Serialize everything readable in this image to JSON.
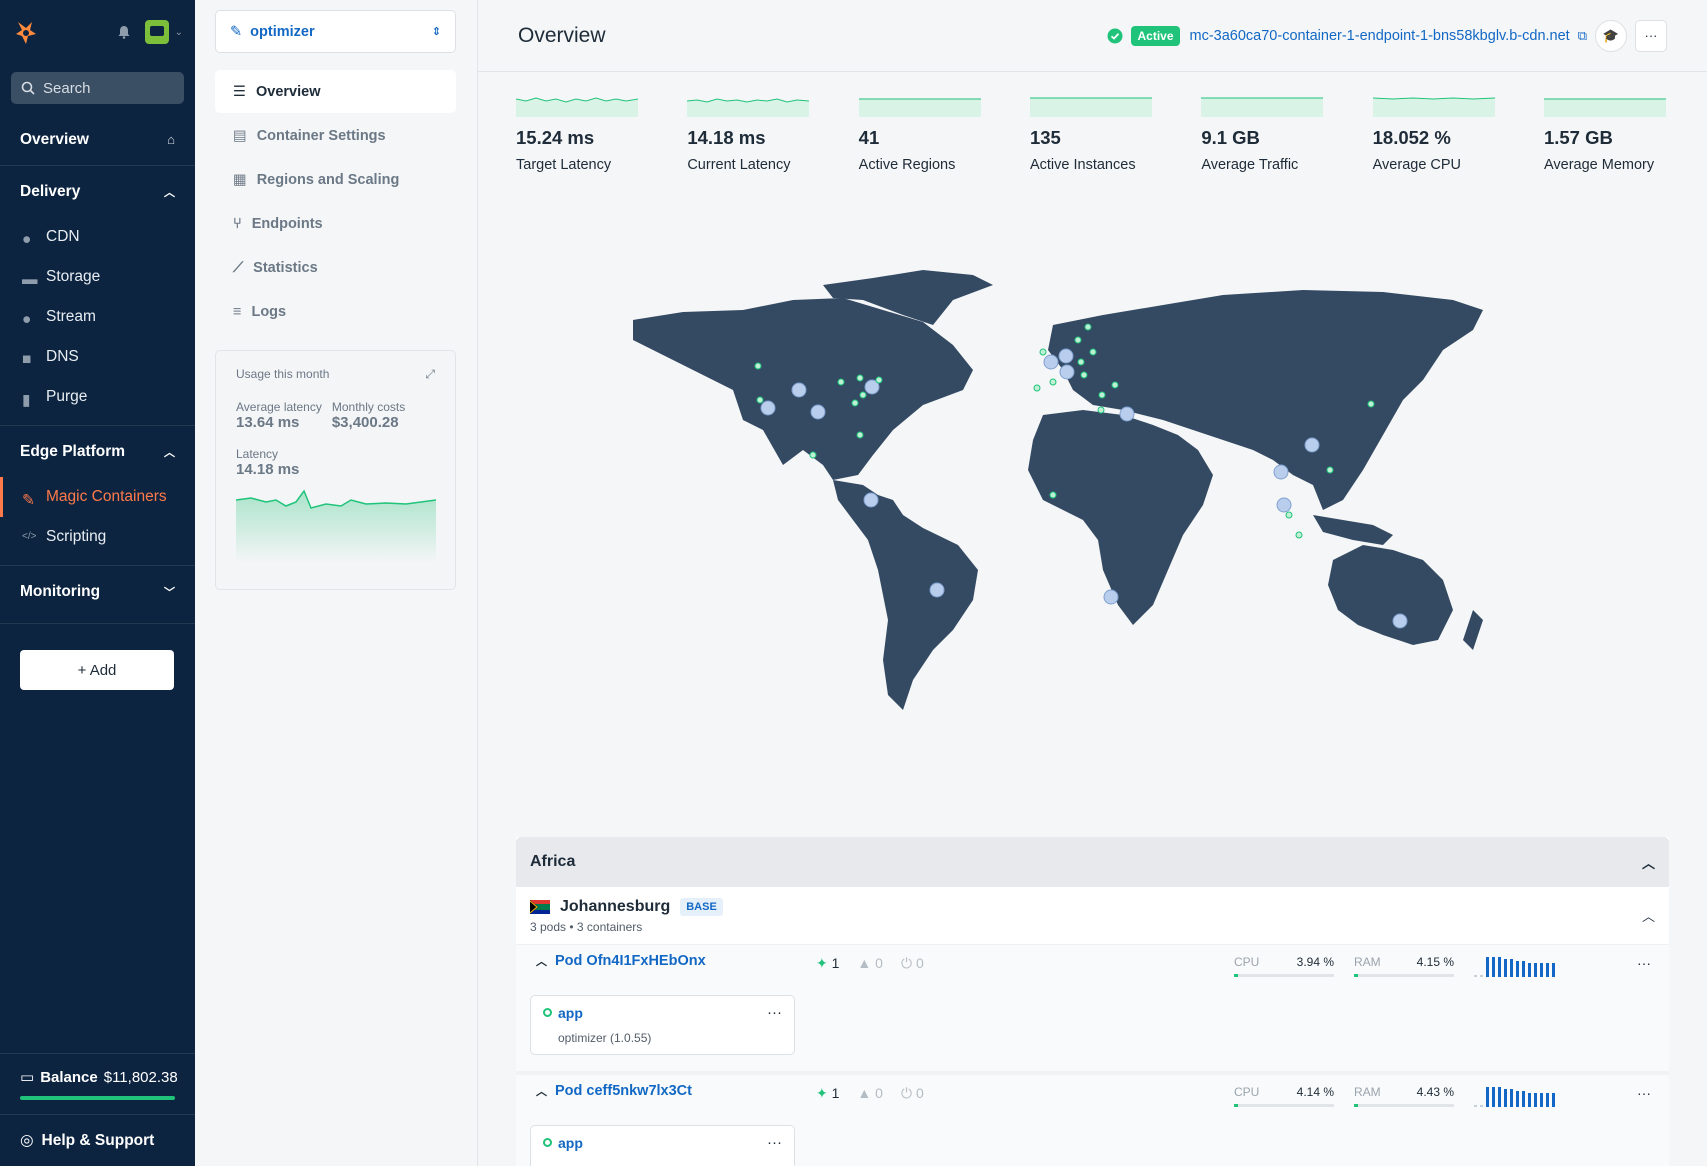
{
  "sidebar": {
    "search_placeholder": "Search",
    "overview": "Overview",
    "delivery": {
      "title": "Delivery",
      "items": [
        "CDN",
        "Storage",
        "Stream",
        "DNS",
        "Purge"
      ]
    },
    "edge": {
      "title": "Edge Platform",
      "items": [
        "Magic Containers",
        "Scripting"
      ]
    },
    "monitoring": "Monitoring",
    "add": "+ Add",
    "balance_label": "Balance",
    "balance_value": "$11,802.38",
    "help": "Help & Support"
  },
  "subnav": {
    "app": "optimizer",
    "items": [
      "Overview",
      "Container Settings",
      "Regions and Scaling",
      "Endpoints",
      "Statistics",
      "Logs"
    ],
    "usage": {
      "title": "Usage this month",
      "avg_latency_label": "Average latency",
      "avg_latency": "13.64 ms",
      "monthly_costs_label": "Monthly costs",
      "monthly_costs": "$3,400.28",
      "latency_label": "Latency",
      "latency": "14.18 ms"
    }
  },
  "header": {
    "title": "Overview",
    "status": "Active",
    "endpoint": "mc-3a60ca70-container-1-endpoint-1-bns58kbglv.b-cdn.net"
  },
  "stats": [
    {
      "value": "15.24 ms",
      "label": "Target Latency"
    },
    {
      "value": "14.18 ms",
      "label": "Current Latency"
    },
    {
      "value": "41",
      "label": "Active Regions"
    },
    {
      "value": "135",
      "label": "Active Instances"
    },
    {
      "value": "9.1 GB",
      "label": "Average Traffic"
    },
    {
      "value": "18.052 %",
      "label": "Average CPU"
    },
    {
      "value": "1.57 GB",
      "label": "Average Memory"
    }
  ],
  "region": {
    "name": "Africa",
    "city": {
      "name": "Johannesburg",
      "badge": "BASE",
      "meta": "3 pods • 3 containers"
    },
    "pods": [
      {
        "name": "Pod Ofn4I1FxHEbOnx",
        "running": "1",
        "failed": "0",
        "stopped": "0",
        "cpu_label": "CPU",
        "cpu": "3.94 %",
        "cpu_pct": 3.94,
        "ram_label": "RAM",
        "ram": "4.15 %",
        "ram_pct": 4.15,
        "container": "app",
        "version": "optimizer (1.0.55)"
      },
      {
        "name": "Pod ceff5nkw7lx3Ct",
        "running": "1",
        "failed": "0",
        "stopped": "0",
        "cpu_label": "CPU",
        "cpu": "4.14 %",
        "cpu_pct": 4.14,
        "ram_label": "RAM",
        "ram": "4.43 %",
        "ram_pct": 4.43,
        "container": "app",
        "version": ""
      }
    ]
  },
  "colors": {
    "sidebar_bg": "#0c2440",
    "accent": "#ff7a4a",
    "link": "#1268c4",
    "success": "#1fc37a",
    "map_land": "#344a63"
  },
  "icons": {
    "logo": "bunny-logo-icon",
    "bell": "bell-icon",
    "search": "search-icon",
    "home": "home-icon",
    "container": "magic-wand-icon",
    "globe": "external-link-icon",
    "cap": "graduation-cap-icon"
  }
}
